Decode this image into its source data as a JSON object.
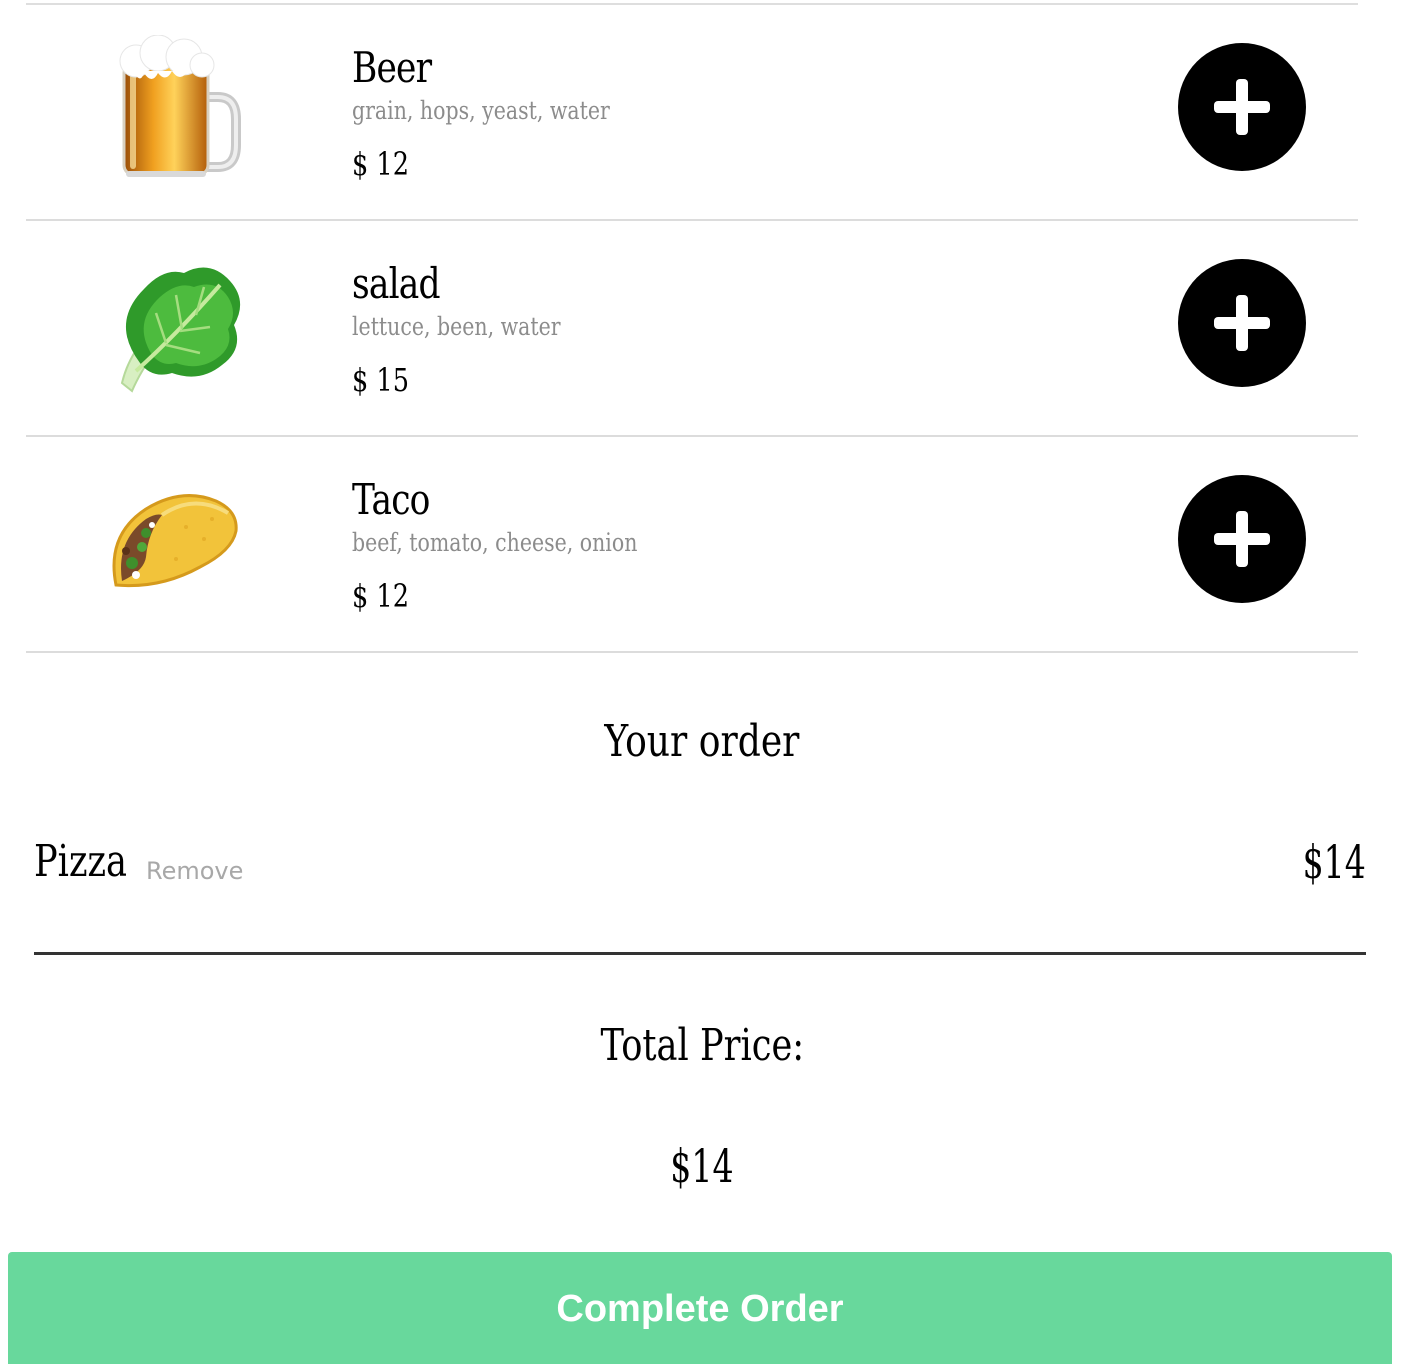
{
  "menu": {
    "items": [
      {
        "name": "Beer",
        "ingredients": "grain, hops, yeast, water",
        "price": "$ 12",
        "icon": "beer-mug-icon"
      },
      {
        "name": "salad",
        "ingredients": "lettuce, been, water",
        "price": "$ 15",
        "icon": "leafy-green-icon"
      },
      {
        "name": "Taco",
        "ingredients": "beef, tomato, cheese, onion",
        "price": "$ 12",
        "icon": "taco-icon"
      }
    ]
  },
  "order": {
    "title": "Your order",
    "items": [
      {
        "name": "Pizza",
        "remove_label": "Remove",
        "price": "$14"
      }
    ],
    "total_label": "Total Price:",
    "total_value": "$14",
    "complete_label": "Complete Order"
  },
  "colors": {
    "complete_button": "#68d89c",
    "add_button": "#000000",
    "ingredients_text": "#8c8c8c",
    "remove_text": "#a8a8a8"
  }
}
